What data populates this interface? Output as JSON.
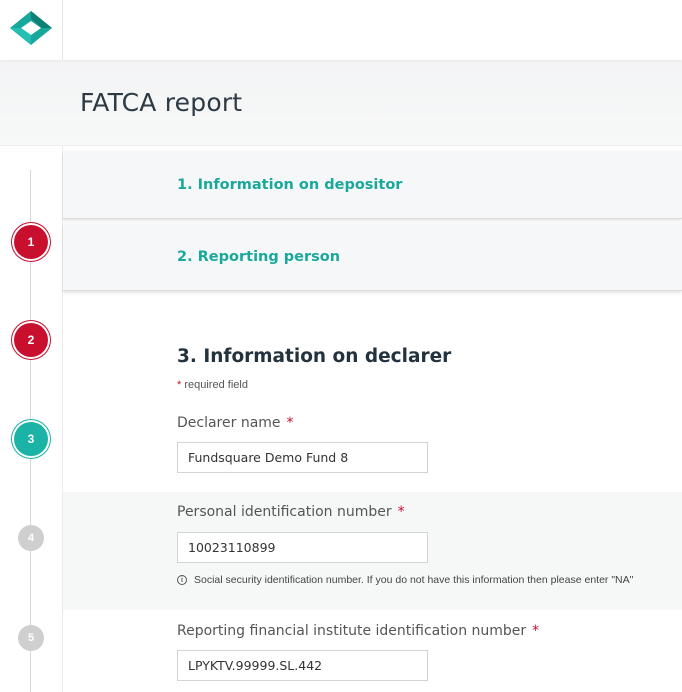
{
  "app": {
    "page_title": "FATCA report",
    "brand_color": "#1ab3a6",
    "accent_red": "#c8102e"
  },
  "steps": [
    {
      "number": "1",
      "state": "done"
    },
    {
      "number": "2",
      "state": "done"
    },
    {
      "number": "3",
      "state": "current"
    },
    {
      "number": "4",
      "state": "todo"
    },
    {
      "number": "5",
      "state": "todo"
    }
  ],
  "sections": {
    "depositor": "1. Information on depositor",
    "reporting_person": "2. Reporting person",
    "declarer": "3. Information on declarer"
  },
  "form": {
    "required_note": "required field",
    "required_marker": "*",
    "declarer_name": {
      "label": "Declarer name",
      "value": "Fundsquare Demo Fund 8"
    },
    "personal_id": {
      "label": "Personal identification number",
      "value": "10023110899",
      "hint": "Social security identification number. If you do not have this information then please enter \"NA\""
    },
    "fi_id": {
      "label": "Reporting financial institute identification number",
      "value": "LPYKTV.99999.SL.442"
    }
  },
  "icons": {
    "logo": "diamond-logo-icon",
    "info": "info-icon"
  }
}
